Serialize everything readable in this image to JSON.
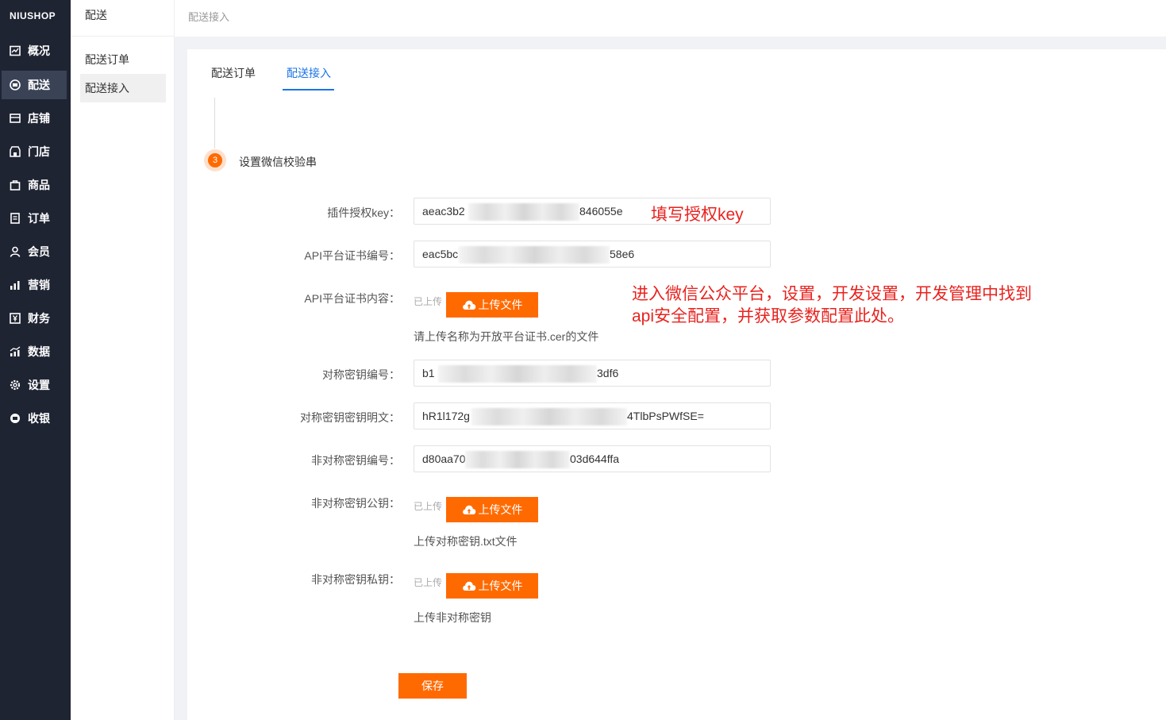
{
  "nav": {
    "logo": "NIUSHOP",
    "items": [
      {
        "label": "概况",
        "icon": "overview-icon"
      },
      {
        "label": "配送",
        "icon": "delivery-icon"
      },
      {
        "label": "店铺",
        "icon": "shop-icon"
      },
      {
        "label": "门店",
        "icon": "store-icon"
      },
      {
        "label": "商品",
        "icon": "goods-icon"
      },
      {
        "label": "订单",
        "icon": "order-icon"
      },
      {
        "label": "会员",
        "icon": "member-icon"
      },
      {
        "label": "营销",
        "icon": "marketing-icon"
      },
      {
        "label": "财务",
        "icon": "finance-icon"
      },
      {
        "label": "数据",
        "icon": "data-icon"
      },
      {
        "label": "设置",
        "icon": "settings-icon"
      },
      {
        "label": "收银",
        "icon": "cashier-icon"
      }
    ],
    "active": "配送"
  },
  "subnav": {
    "title": "配送",
    "items": [
      "配送订单",
      "配送接入"
    ],
    "active": "配送接入"
  },
  "breadcrumb": "配送接入",
  "tabs": [
    "配送订单",
    "配送接入"
  ],
  "active_tab": "配送接入",
  "step": {
    "number": "3",
    "title": "设置微信校验串"
  },
  "form": {
    "auth_key": {
      "label": "插件授权key：",
      "value_start": "aeac3b2",
      "value_end": "846055e"
    },
    "cert_no": {
      "label": "API平台证书编号：",
      "value_start": "eac5bc",
      "value_end": "58e6"
    },
    "cert_content": {
      "label": "API平台证书内容：",
      "uploaded": "已上传",
      "button": "上传文件",
      "hint": "请上传名称为开放平台证书.cer的文件"
    },
    "sym_key_no": {
      "label": "对称密钥编号：",
      "value_start": "b1",
      "value_end": "3df6"
    },
    "sym_key_plain": {
      "label": "对称密钥密钥明文：",
      "value_start": "hR1l172g",
      "value_end": "4TlbPsPWfSE="
    },
    "asym_key_no": {
      "label": "非对称密钥编号：",
      "value_start": "d80aa70",
      "value_end": "03d644ffa"
    },
    "asym_pub": {
      "label": "非对称密钥公钥：",
      "uploaded": "已上传",
      "button": "上传文件",
      "hint": "上传对称密钥.txt文件"
    },
    "asym_priv": {
      "label": "非对称密钥私钥：",
      "uploaded": "已上传",
      "button": "上传文件",
      "hint": "上传非对称密钥"
    }
  },
  "save_label": "保存",
  "annotations": {
    "key_note": "填写授权key",
    "config_note_line1": "进入微信公众平台，设置，开发设置，开发管理中找到",
    "config_note_line2": "api安全配置，并获取参数配置此处。"
  },
  "colors": {
    "nav_bg": "#1f2433",
    "accent": "#ff6a00",
    "tab_active": "#1a73e8",
    "annotation": "#e8231f"
  }
}
